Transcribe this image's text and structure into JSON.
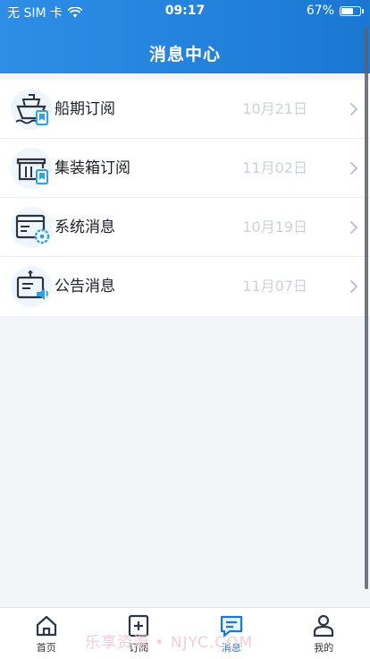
{
  "status_bar": {
    "carrier": "无 SIM 卡",
    "time": "09:17",
    "battery": "67%",
    "battery_level": 0.67
  },
  "header": {
    "title": "消息中心"
  },
  "messages": [
    {
      "label": "船期订阅",
      "date": "10月21日",
      "icon": "ship-subscribe-icon"
    },
    {
      "label": "集装箱订阅",
      "date": "11月02日",
      "icon": "container-subscribe-icon"
    },
    {
      "label": "系统消息",
      "date": "10月19日",
      "icon": "system-settings-icon"
    },
    {
      "label": "公告消息",
      "date": "11月07日",
      "icon": "announcement-icon"
    }
  ],
  "tabbar": {
    "items": [
      {
        "label": "首页",
        "icon": "home-icon"
      },
      {
        "label": "订阅",
        "icon": "subscribe-plus-icon"
      },
      {
        "label": "消息",
        "icon": "message-icon",
        "active": true
      },
      {
        "label": "我的",
        "icon": "profile-icon"
      }
    ]
  },
  "watermark": "乐享资源 • NJYC.COM",
  "colors": {
    "header": "#1a78d2",
    "active_tab": "#1a78d2",
    "date": "#cdd1da"
  }
}
